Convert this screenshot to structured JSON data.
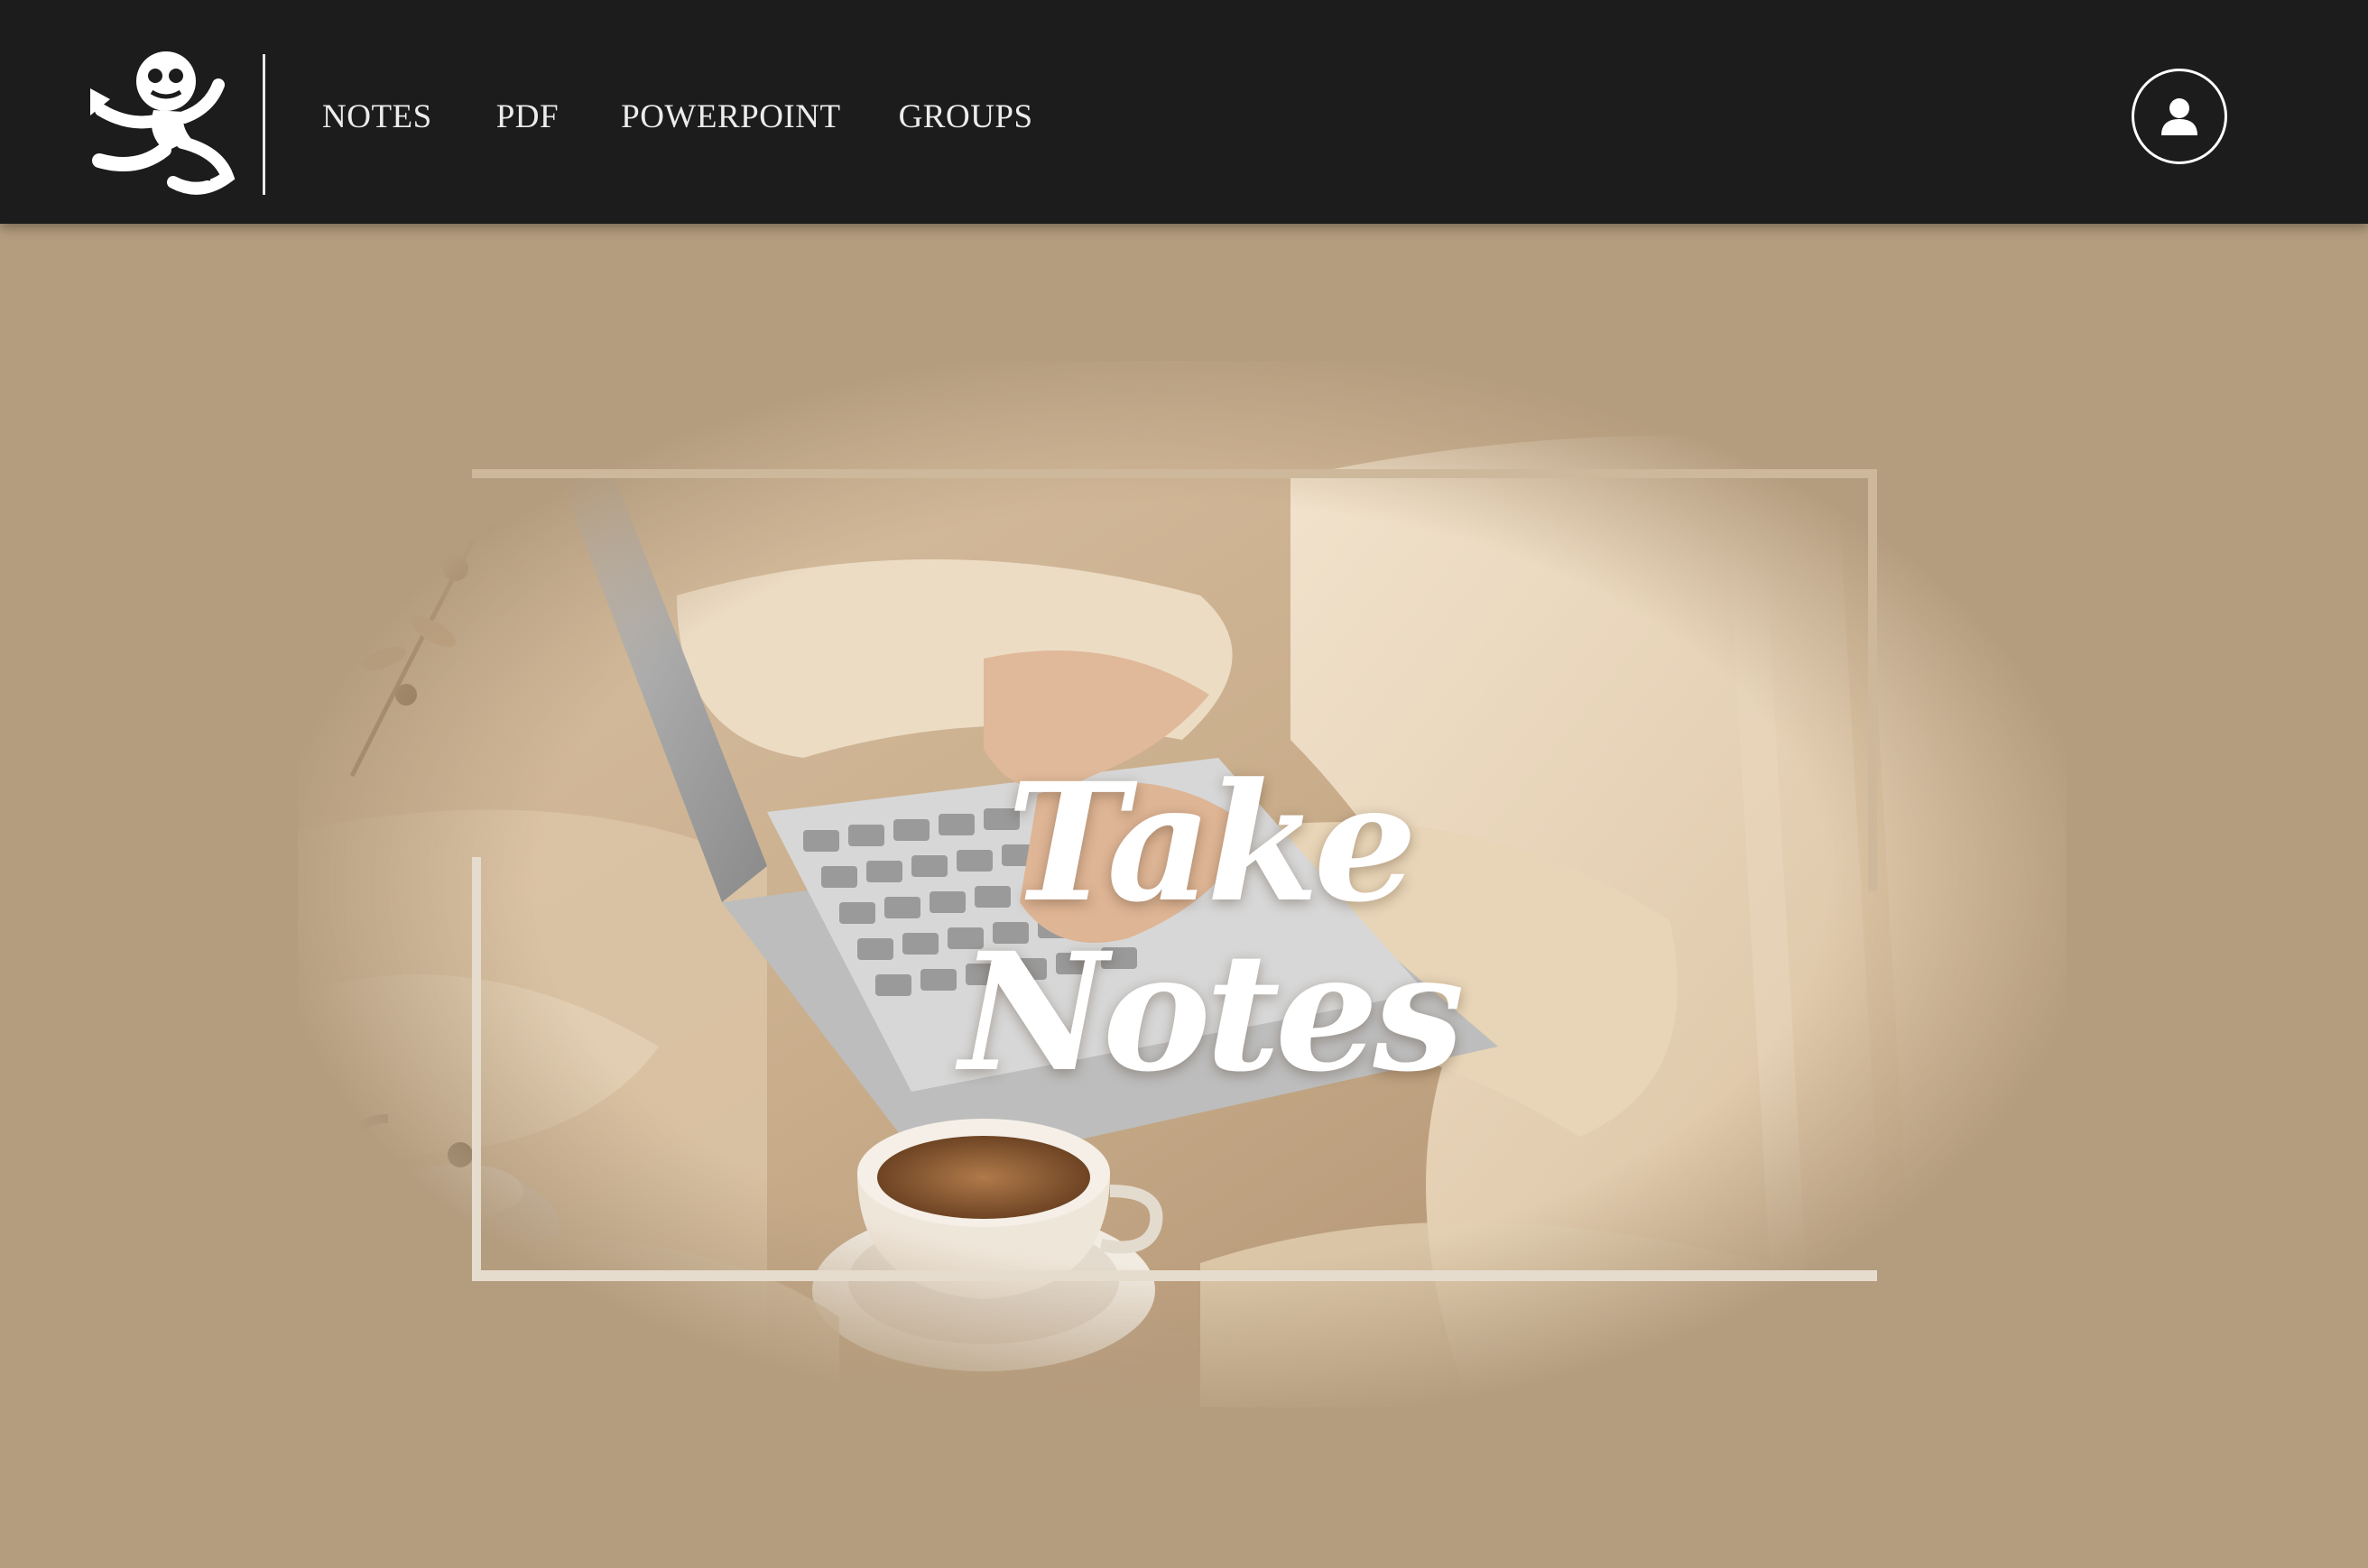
{
  "navbar": {
    "logo_icon": "monkey-logo-icon",
    "links": [
      {
        "label": "NOTES"
      },
      {
        "label": "PDF"
      },
      {
        "label": "POWERPOINT"
      },
      {
        "label": "GROUPS"
      }
    ],
    "account_icon": "user-icon"
  },
  "hero": {
    "title_line1": "Take",
    "title_line2": "Notes",
    "image_subject": "hands typing on laptop with cup of tea on beige linen"
  },
  "colors": {
    "navbar_bg": "#1c1c1c",
    "page_bg": "#b49c7e",
    "nav_text": "#ececec",
    "frame": "#e6dccd",
    "title": "#ffffff"
  }
}
